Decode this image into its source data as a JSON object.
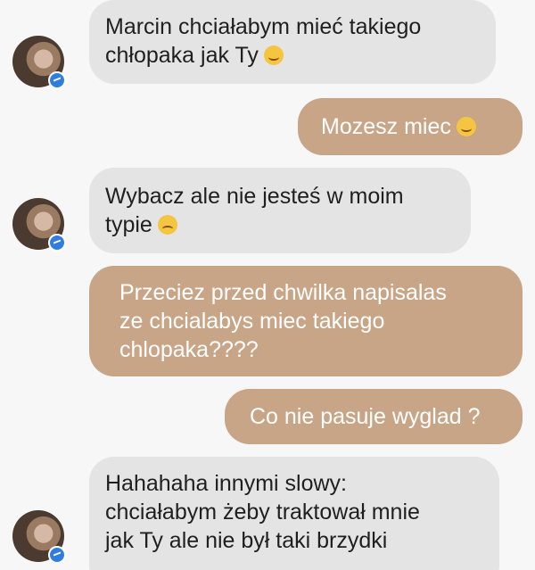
{
  "messages": [
    {
      "side": "in",
      "lines": [
        "Marcin chciałabym mieć takiego",
        "chłopaka jak Ty"
      ],
      "emoji": "laughing-emoji"
    },
    {
      "side": "out",
      "lines": [
        "Mozesz miec"
      ],
      "emoji": "smiling-emoji"
    },
    {
      "side": "in",
      "lines": [
        "Wybacz ale nie jesteś w moim",
        "typie"
      ],
      "emoji": "sad-emoji"
    },
    {
      "side": "out",
      "lines": [
        "Przeciez przed chwilka napisalas",
        "ze chcialabys miec takiego",
        "chlopaka????"
      ]
    },
    {
      "side": "out",
      "lines": [
        "Co nie pasuje wyglad ?"
      ]
    },
    {
      "side": "in",
      "lines": [
        "Hahahaha innymi slowy:",
        "chciałabym żeby traktował mnie",
        "jak Ty ale nie był taki brzydki"
      ]
    }
  ],
  "colors": {
    "incoming_bubble": "#e4e4e4",
    "outgoing_bubble": "#c7a586",
    "messenger_badge": "#2f7de1"
  }
}
